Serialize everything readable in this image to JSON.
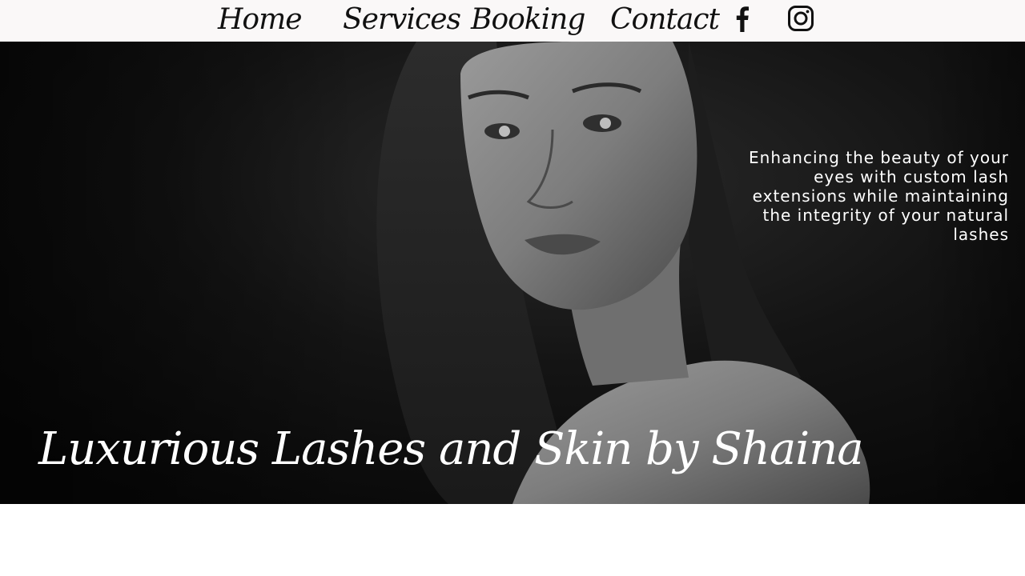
{
  "nav": {
    "home": "Home",
    "services": "Services",
    "booking": "Booking",
    "contact": "Contact",
    "icons": [
      "facebook-icon",
      "instagram-icon"
    ]
  },
  "hero": {
    "tagline": "Enhancing the beauty of your eyes with custom lash extensions while maintaining the integrity of your natural lashes",
    "title": "Luxurious Lashes and Skin by Shaina"
  },
  "colors": {
    "nav_bg": "#faf8f8",
    "nav_text": "#111111",
    "hero_bg": "#0d0d0d",
    "hero_text": "#ffffff"
  }
}
